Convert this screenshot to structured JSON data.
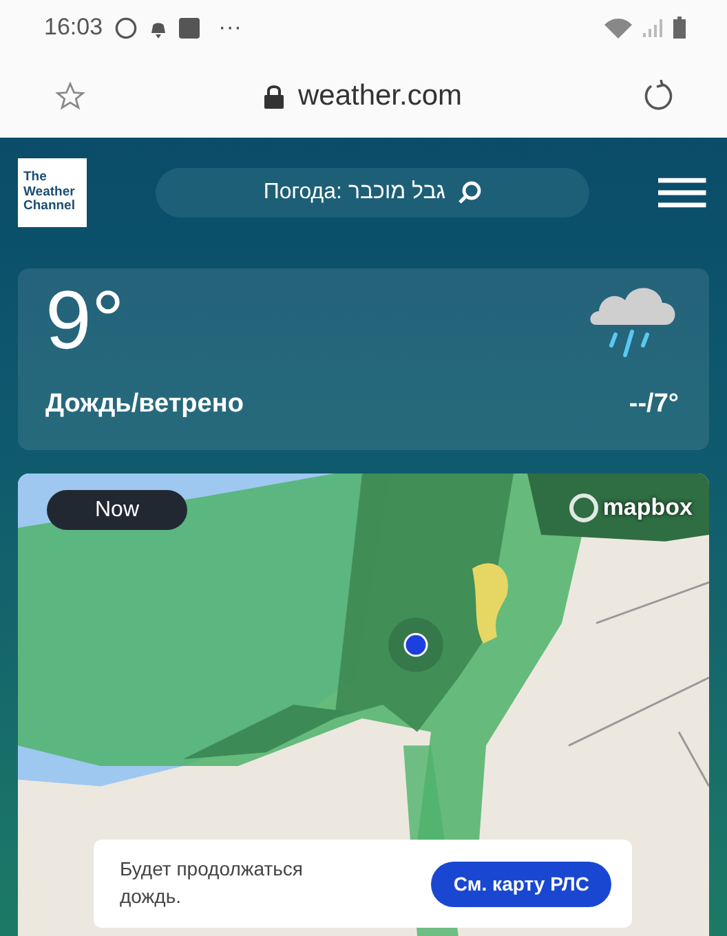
{
  "status_bar": {
    "time": "16:03",
    "more": "···"
  },
  "browser": {
    "url": "weather.com"
  },
  "header": {
    "logo": [
      "The",
      "Weather",
      "Channel"
    ],
    "search": "Погода: גבל מוכבר"
  },
  "current": {
    "temperature": "9°",
    "condition": "Дождь/ветрено",
    "hi_lo": "--/7°"
  },
  "map": {
    "time_label": "Now",
    "attribution": "mapbox",
    "message": "Будет продолжаться дождь.",
    "button": "См. карту РЛС"
  }
}
